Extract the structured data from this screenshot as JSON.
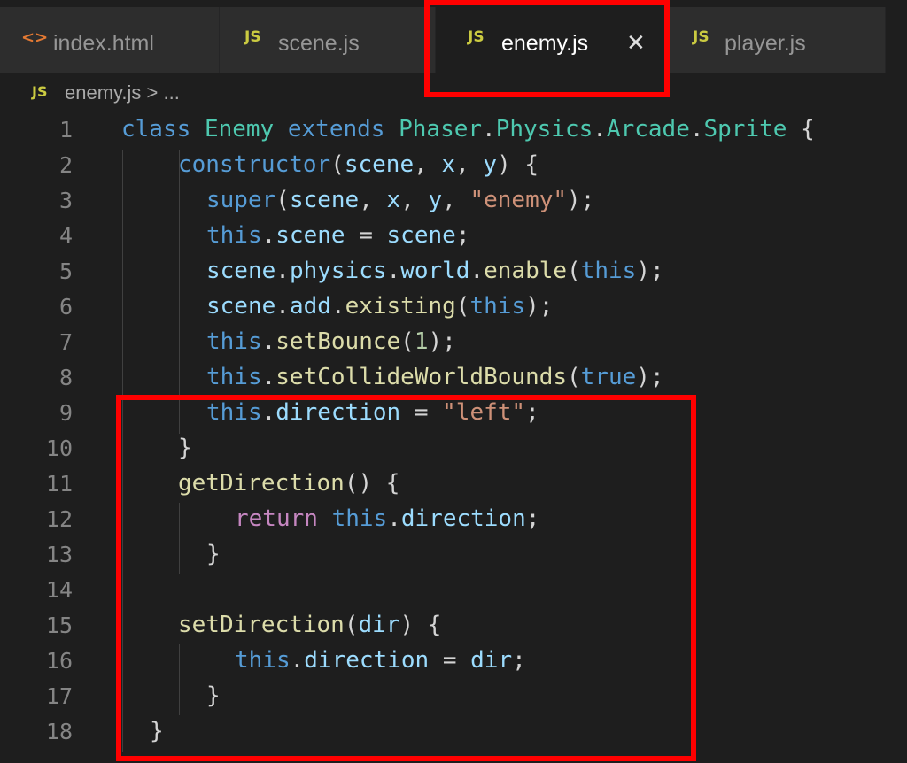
{
  "tabs": [
    {
      "icon": "<>",
      "label": "index.html"
    },
    {
      "icon": "JS",
      "label": "scene.js"
    },
    {
      "icon": "JS",
      "label": "enemy.js",
      "close": "✕"
    },
    {
      "icon": "JS",
      "label": "player.js"
    }
  ],
  "breadcrumb": {
    "icon": "JS",
    "path": "enemy.js > ..."
  },
  "code": {
    "line_numbers": [
      "1",
      "2",
      "3",
      "4",
      "5",
      "6",
      "7",
      "8",
      "9",
      "10",
      "11",
      "12",
      "13",
      "14",
      "15",
      "16",
      "17",
      "18"
    ],
    "lines": [
      "class Enemy extends Phaser.Physics.Arcade.Sprite {",
      "constructor(scene, x, y) {",
      "super(scene, x, y, \"enemy\");",
      "this.scene = scene;",
      "scene.physics.world.enable(this);",
      "scene.add.existing(this);",
      "this.setBounce(1);",
      "this.setCollideWorldBounds(true);",
      "this.direction = \"left\";",
      "}",
      "getDirection() {",
      "return this.direction;",
      "}",
      "",
      "setDirection(dir) {",
      "this.direction = dir;",
      "}",
      "}"
    ]
  },
  "colors": {
    "keyword": "#569cd6",
    "class": "#4ec9b0",
    "function": "#dcdcaa",
    "variable": "#9cdcfe",
    "string": "#ce9178",
    "number": "#b5cea8",
    "control": "#c586c0",
    "highlight": "#ff0000"
  }
}
